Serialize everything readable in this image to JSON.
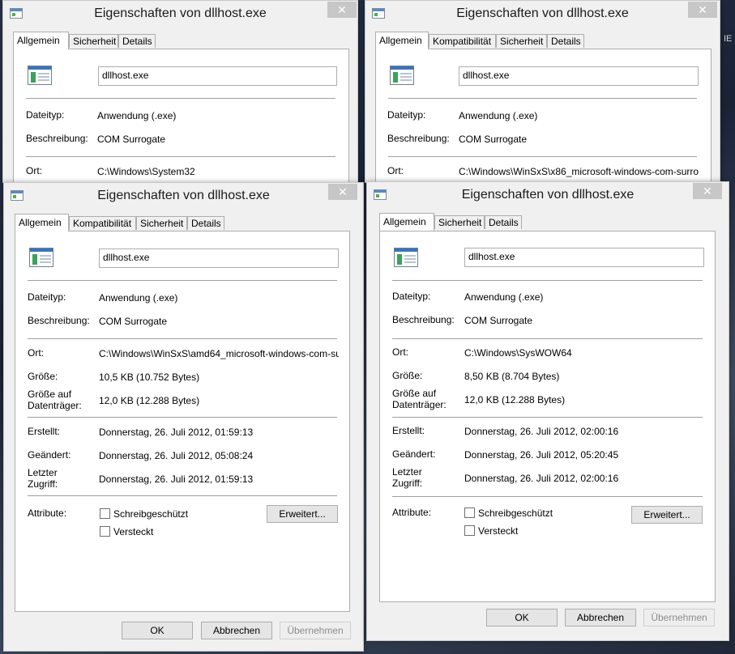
{
  "background": {
    "side_text": "IE"
  },
  "window_1": {
    "title": "Eigenschaften von dllhost.exe",
    "close": "✕",
    "tabs": [
      "Allgemein",
      "Sicherheit",
      "Details"
    ],
    "filename": "dllhost.exe",
    "labels": {
      "type": "Dateityp:",
      "desc": "Beschreibung:",
      "loc": "Ort:"
    },
    "values": {
      "type": "Anwendung (.exe)",
      "desc": "COM Surrogate",
      "loc": "C:\\Windows\\System32"
    }
  },
  "window_2": {
    "title": "Eigenschaften von dllhost.exe",
    "close": "✕",
    "tabs": [
      "Allgemein",
      "Kompatibilität",
      "Sicherheit",
      "Details"
    ],
    "filename": "dllhost.exe",
    "labels": {
      "type": "Dateityp:",
      "desc": "Beschreibung:",
      "loc": "Ort:"
    },
    "values": {
      "type": "Anwendung (.exe)",
      "desc": "COM Surrogate",
      "loc": "C:\\Windows\\WinSxS\\x86_microsoft-windows-com-surro"
    }
  },
  "window_3": {
    "title": "Eigenschaften von dllhost.exe",
    "close": "✕",
    "tabs": [
      "Allgemein",
      "Kompatibilität",
      "Sicherheit",
      "Details"
    ],
    "filename": "dllhost.exe",
    "labels": {
      "type": "Dateityp:",
      "desc": "Beschreibung:",
      "loc": "Ort:",
      "size": "Größe:",
      "disk1": "Größe auf",
      "disk2": "Datenträger:",
      "created": "Erstellt:",
      "modified": "Geändert:",
      "access1": "Letzter",
      "access2": "Zugriff:",
      "attrs": "Attribute:"
    },
    "values": {
      "type": "Anwendung (.exe)",
      "desc": "COM Surrogate",
      "loc": "C:\\Windows\\WinSxS\\amd64_microsoft-windows-com-su",
      "size": "10,5 KB (10.752 Bytes)",
      "disk": "12,0 KB (12.288 Bytes)",
      "created": "Donnerstag, 26. Juli 2012, 01:59:13",
      "modified": "Donnerstag, 26. Juli 2012, 05:08:24",
      "access": "Donnerstag, 26. Juli 2012, 01:59:13"
    },
    "checkboxes": {
      "readonly": "Schreibgeschützt",
      "hidden": "Versteckt"
    },
    "buttons": {
      "advanced": "Erweitert...",
      "ok": "OK",
      "cancel": "Abbrechen",
      "apply": "Übernehmen"
    }
  },
  "window_4": {
    "title": "Eigenschaften von dllhost.exe",
    "close": "✕",
    "tabs": [
      "Allgemein",
      "Sicherheit",
      "Details"
    ],
    "filename": "dllhost.exe",
    "labels": {
      "type": "Dateityp:",
      "desc": "Beschreibung:",
      "loc": "Ort:",
      "size": "Größe:",
      "disk1": "Größe auf",
      "disk2": "Datenträger:",
      "created": "Erstellt:",
      "modified": "Geändert:",
      "access1": "Letzter",
      "access2": "Zugriff:",
      "attrs": "Attribute:"
    },
    "values": {
      "type": "Anwendung (.exe)",
      "desc": "COM Surrogate",
      "loc": "C:\\Windows\\SysWOW64",
      "size": "8,50 KB (8.704 Bytes)",
      "disk": "12,0 KB (12.288 Bytes)",
      "created": "Donnerstag, 26. Juli 2012, 02:00:16",
      "modified": "Donnerstag, 26. Juli 2012, 05:20:45",
      "access": "Donnerstag, 26. Juli 2012, 02:00:16"
    },
    "checkboxes": {
      "readonly": "Schreibgeschützt",
      "hidden": "Versteckt"
    },
    "buttons": {
      "advanced": "Erweitert...",
      "ok": "OK",
      "cancel": "Abbrechen",
      "apply": "Übernehmen"
    }
  }
}
